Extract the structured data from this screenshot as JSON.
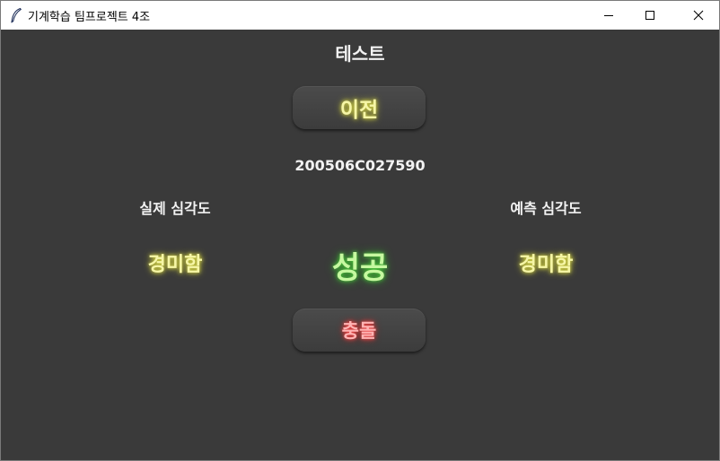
{
  "window": {
    "title": "기계학습 팀프로젝트 4조",
    "icons": {
      "app": "feather-icon",
      "minimize": "minimize-icon",
      "maximize": "maximize-icon",
      "close": "close-icon"
    }
  },
  "main": {
    "heading": "테스트",
    "prev_button_label": "이전",
    "sample_id": "200506C027590",
    "actual_label": "실제 심각도",
    "predicted_label": "예측 심각도",
    "actual_value": "경미함",
    "result": "성공",
    "predicted_value": "경미함",
    "collision_button_label": "충돌"
  },
  "colors": {
    "background": "#3a3a3a",
    "text": "#f2f2f2",
    "severity_glow": "#e2e24a",
    "success_glow": "#4fd43a",
    "collision_glow": "#ff4a4a"
  }
}
